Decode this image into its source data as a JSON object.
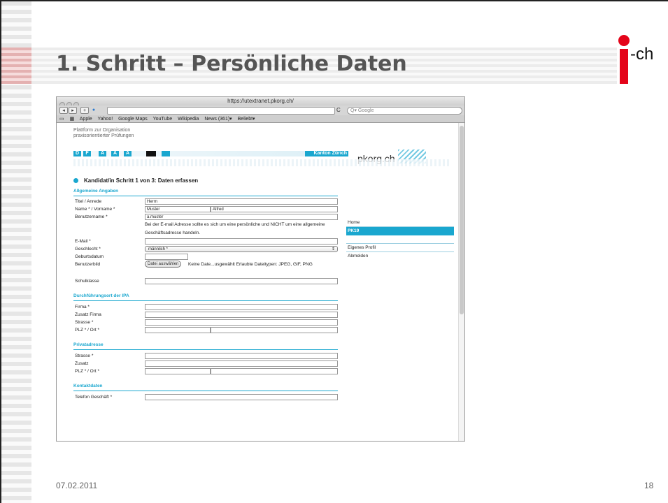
{
  "slide": {
    "title": "1. Schritt – Persönliche Daten",
    "logo_text": "-ch",
    "date": "07.02.2011",
    "page_number": "18",
    "accent_color": "#e4051a"
  },
  "browser": {
    "window_title": "https://utextranet.pkorg.ch/",
    "search_placeholder": "Google",
    "bookmarks": [
      "Apple",
      "Yahoo!",
      "Google Maps",
      "YouTube",
      "Wikipedia",
      "News (361)▾",
      "Beliebt▾"
    ],
    "icons": [
      "back-icon",
      "forward-icon",
      "add-icon",
      "reload-icon",
      "search-icon",
      "bookmarks-icon",
      "grid-icon"
    ]
  },
  "site": {
    "platform_line1": "Plattform zur Organisation",
    "platform_line2": "praxisorientierter Prüfungen",
    "languages": [
      "D",
      "F",
      "A",
      "A",
      "A"
    ],
    "kanton": "Kanton Zürich",
    "brand": "pkorg.ch",
    "brand_color": "#1aa7cf",
    "step_title": "Kandidat/in Schritt 1 von 3: Daten erfassen",
    "nav": [
      "Home",
      "PK19",
      "Eigenes Profil",
      "Abmelden"
    ]
  },
  "form": {
    "sections": {
      "general": "Allgemeine Angaben",
      "ipa": "Durchführungsort der IPA",
      "private": "Privatadresse",
      "contact": "Kontaktdaten"
    },
    "labels": {
      "title": "Titel / Anrede",
      "name": "Name * / Vorname *",
      "username": "Benutzername *",
      "email": "E-Mail *",
      "gender": "Geschlecht *",
      "birthdate": "Geburtsdatum",
      "picture": "Benutzerbild",
      "school_class": "Schulklasse",
      "company": "Firma *",
      "company_extra": "Zusatz Firma",
      "street": "Strasse *",
      "zip_city": "PLZ * / Ort *",
      "priv_street": "Strasse *",
      "priv_extra": "Zusatz",
      "priv_zip_city": "PLZ * / Ort *",
      "phone_business": "Telefon Geschäft *"
    },
    "values": {
      "title": "Herrn",
      "lastname": "Muster",
      "firstname": "Alfred",
      "username": "a.muster",
      "gender": "männlich *"
    },
    "email_hint": "Bei der E-mail Adresse sollte es sich um eine persönliche und NICHT um eine allgemeine Geschäftsadresse handeln.",
    "file_button": "Datei auswählen",
    "file_text": "Keine Date...usgewählt  Erlaubte Dateitypen: JPEG, GIF, PNG"
  }
}
